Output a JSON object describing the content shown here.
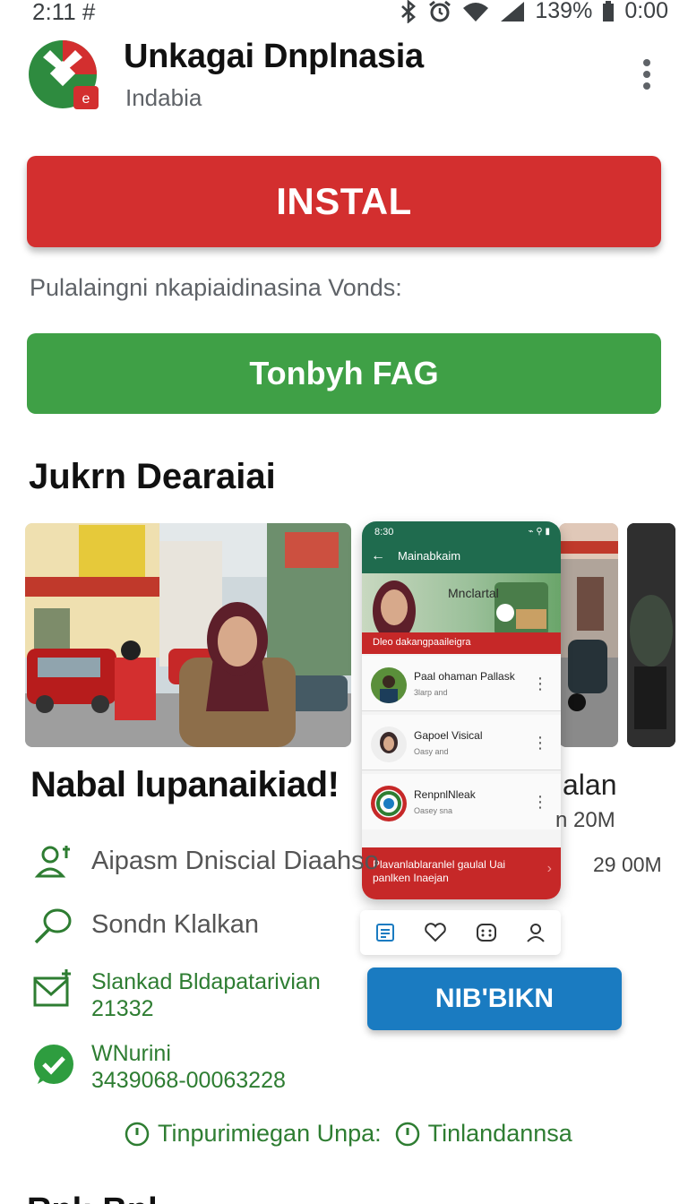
{
  "status_bar": {
    "time": "2:11",
    "time_icon": "#",
    "battery_percent": "139%",
    "right_time": "0:00"
  },
  "app": {
    "title": "Unkagai Dnplnasia",
    "developer": "Indabia",
    "brand_colors": {
      "red": "#d32f2f",
      "green": "#2e8b3f",
      "blue": "#1a7bc1"
    }
  },
  "actions": {
    "install_label": "INSTAL",
    "subline": "Pulalaingni nkapiaidinasina Vonds:",
    "faq_label": "Tonbyh FAG",
    "nibbikn_label": "NIB'BIKN"
  },
  "screenshots": {
    "section_title": "Jukrn Dearaiai",
    "phone": {
      "clock": "8:30",
      "header_title": "Mainabkaim",
      "banner_title": "Mnclartal",
      "strip_text": "Dleo dakangpaaileigra",
      "rows": [
        {
          "name": "Paal ohaman Pallask",
          "sub": "3larp and"
        },
        {
          "name": "Gapoel Visical",
          "sub": "Oasy and"
        },
        {
          "name": "RenpnlNleak",
          "sub": "Oasey sna"
        }
      ],
      "footer_text": "Plavanlablaranlel gaulal Uai panlken Inaejan"
    }
  },
  "details": {
    "title": "Nabal lupanaikiad!",
    "partial_a": "alan",
    "partial_b": "n 20M",
    "size": "29 00M",
    "items": [
      {
        "icon": "person-location-icon",
        "text": "Aipasm Dniscial Diaahso"
      },
      {
        "icon": "leaf-icon",
        "text": "Sondn Klalkan"
      },
      {
        "icon": "mail-plus-icon",
        "line1": "Slankad Bldapatarivian",
        "line2": "21332"
      },
      {
        "icon": "whatsapp-check-icon",
        "line1": "WNurini",
        "line2": "3439068-00063228"
      }
    ]
  },
  "footer": {
    "link1": "Tinpurimiegan Unpa:",
    "link2": "Tinlandannsa",
    "cut_heading": "Rnl: Bnl"
  }
}
